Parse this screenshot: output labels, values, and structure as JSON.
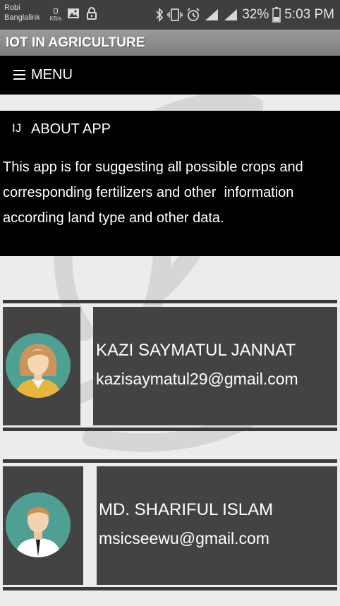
{
  "status_bar": {
    "carrier_line1": "Robi",
    "carrier_line2": "Banglalink",
    "data_speed": "0",
    "data_unit": "KB/s",
    "battery": "32%",
    "time": "5:03 PM",
    "icons": [
      "image-icon",
      "lock-icon",
      "bluetooth-icon",
      "vibrate-icon",
      "alarm-icon",
      "wifi-icon",
      "signal-icon",
      "battery-icon"
    ]
  },
  "app_bar": {
    "title": "IOT IN AGRICULTURE"
  },
  "menu": {
    "label": "MENU",
    "icon": "hamburger-icon"
  },
  "about": {
    "icon_glyph": "IJ",
    "title": "ABOUT APP",
    "text": "This app is for suggesting all possible crops and corresponding fertilizers and other  information according land type and other data."
  },
  "people": [
    {
      "name": "KAZI SAYMATUL JANNAT",
      "email": "kazisaymatul29@gmail.com",
      "avatar": "female-avatar-icon"
    },
    {
      "name": "MD. SHARIFUL ISLAM",
      "email": "msicseewu@gmail.com",
      "avatar": "male-avatar-icon"
    }
  ],
  "colors": {
    "background": "#ececec",
    "status_bar": "#3f3f3f",
    "app_bar": "#8a8a8a",
    "panel": "#000000",
    "card": "#434343",
    "avatar_bg": "#4f9f94"
  }
}
